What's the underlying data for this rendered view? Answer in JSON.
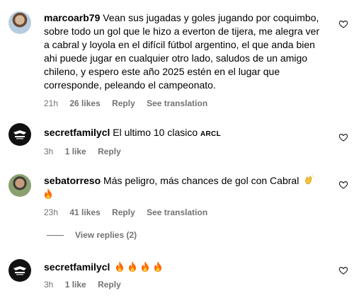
{
  "comments": [
    {
      "username": "marcoarb79",
      "text": "Vean sus jugadas y goles jugando por coquimbo, sobre todo un gol que le hizo a everton de tijera, me alegra ver a cabral y loyola en el difícil fútbol argentino, el que anda bien ahi puede jugar en cualquier otro lado, saludos de un amigo chileno, y espero este año 2025 estén en el lugar que corresponde, peleando el campeonato.",
      "time": "21h",
      "likes": "26 likes",
      "reply": "Reply",
      "translate": "See translation"
    },
    {
      "username": "secretfamilycl",
      "text": "El ultimo 10 clasico",
      "tag": "ARCL",
      "time": "3h",
      "likes": "1 like",
      "reply": "Reply"
    },
    {
      "username": "sebatorreso",
      "text": "Más peligro, más chances de gol con Cabral",
      "time": "23h",
      "likes": "41 likes",
      "reply": "Reply",
      "translate": "See translation",
      "view_replies": "View replies (2)"
    },
    {
      "username": "secretfamilycl",
      "time": "3h",
      "likes": "1 like",
      "reply": "Reply"
    }
  ],
  "icons": {
    "like": "heart-icon",
    "fire": "fire-emoji",
    "clap": "clapping-hands-emoji"
  },
  "colors": {
    "meta": "#737373",
    "fire": "#ff6a00"
  }
}
